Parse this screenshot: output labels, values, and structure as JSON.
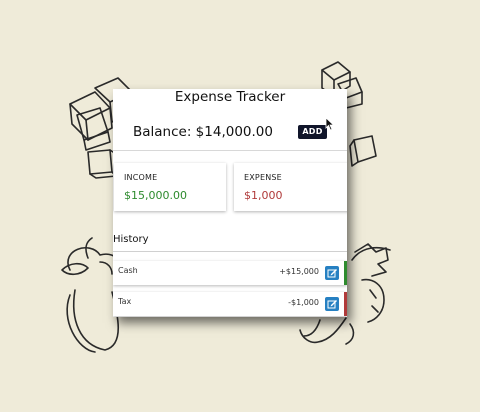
{
  "app": {
    "title": "Expense Tracker",
    "balance_text": "Balance: $14,000.00",
    "add_label": "ADD"
  },
  "summary": {
    "income_label": "INCOME",
    "income_value": "$15,000.00",
    "expense_label": "EXPENSE",
    "expense_value": "$1,000"
  },
  "history": {
    "title": "History",
    "items": [
      {
        "label": "Cash",
        "amount": "+$15,000",
        "type": "income"
      },
      {
        "label": "Tax",
        "amount": "-$1,000",
        "type": "expense"
      }
    ]
  },
  "colors": {
    "background": "#efebd9",
    "income": "#2e8b2e",
    "expense": "#b03a3a",
    "edit_button": "#2680c2",
    "add_button": "#10152a"
  },
  "icons": {
    "edit": "edit-icon",
    "cursor": "mouse-pointer-icon"
  }
}
